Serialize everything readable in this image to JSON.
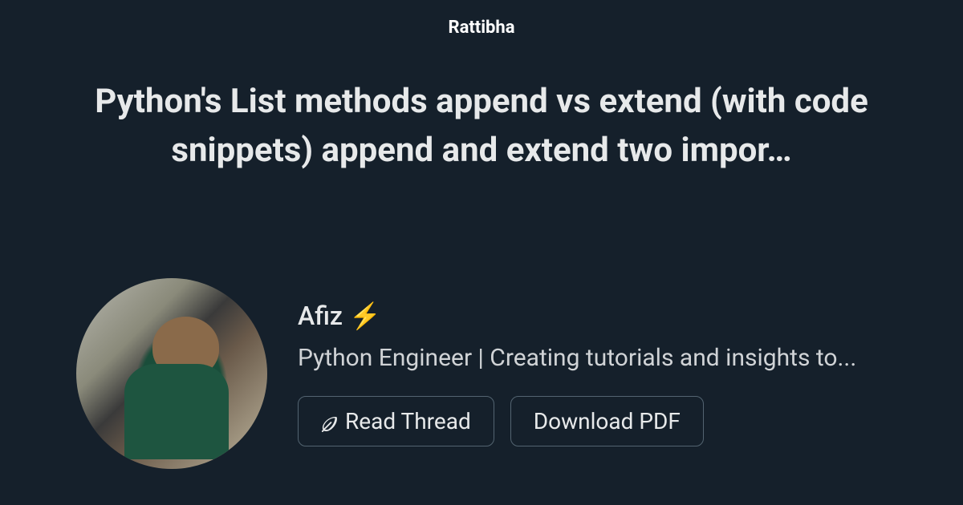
{
  "site_name": "Rattibha",
  "title": "Python's List methods append vs extend (with code snippets) append and extend two impor…",
  "author": {
    "name": "Afiz ⚡",
    "bio": "Python Engineer | Creating tutorials and insights to..."
  },
  "buttons": {
    "read_thread": "Read Thread",
    "download_pdf": "Download PDF"
  }
}
